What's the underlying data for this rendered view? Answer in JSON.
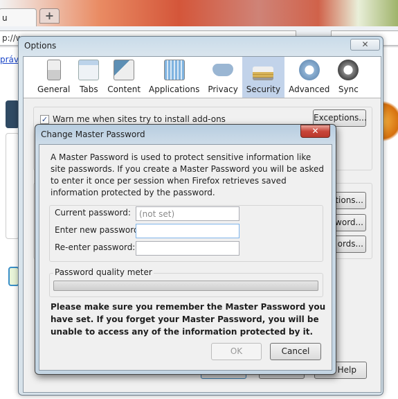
{
  "browser": {
    "tab_label": "u",
    "new_tab": "+",
    "url": "p://ww",
    "link": "práv"
  },
  "options": {
    "title": "Options",
    "close": "✕",
    "toolbar": [
      {
        "label": "General",
        "icon": "general-switch-icon"
      },
      {
        "label": "Tabs",
        "icon": "tabs-folder-icon"
      },
      {
        "label": "Content",
        "icon": "content-icon"
      },
      {
        "label": "Applications",
        "icon": "applications-icon"
      },
      {
        "label": "Privacy",
        "icon": "privacy-mask-icon"
      },
      {
        "label": "Security",
        "icon": "security-lock-icon",
        "selected": true
      },
      {
        "label": "Advanced",
        "icon": "advanced-gear-icon"
      },
      {
        "label": "Sync",
        "icon": "sync-icon"
      }
    ],
    "warn_addons": "Warn me when sites try to install add-ons",
    "warn_addons_checked": true,
    "exceptions": "Exceptions...",
    "partial_buttons": [
      "tions...",
      "word...",
      "ords..."
    ],
    "help": "Help"
  },
  "dialog": {
    "title": "Change Master Password",
    "close": "✕",
    "description": "A Master Password is used to protect sensitive information like site passwords. If you create a Master Password you will be asked to enter it once per session when Firefox retrieves saved information protected by the password.",
    "current_label": "Current password:",
    "current_value": "(not set)",
    "new_label": "Enter new password:",
    "new_value": "",
    "reenter_label": "Re-enter password:",
    "reenter_value": "",
    "meter_label": "Password quality meter",
    "meter_value": 0,
    "warning": "Please make sure you remember the Master Password you have set. If you forget your Master Password, you will be unable to access any of the information protected by it.",
    "ok": "OK",
    "cancel": "Cancel"
  }
}
